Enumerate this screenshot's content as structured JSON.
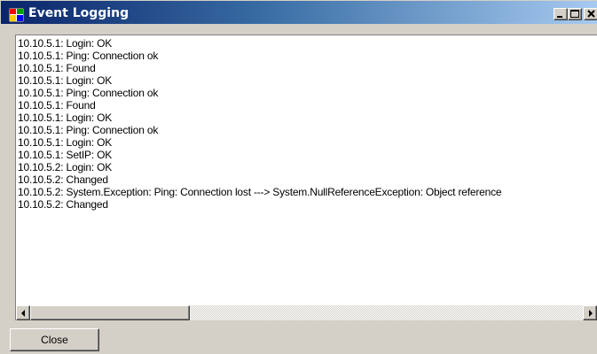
{
  "window": {
    "title": "Event Logging",
    "controls": {
      "minimize_icon": "minimize-icon",
      "maximize_icon": "maximize-icon",
      "close_icon": "close-x-icon"
    }
  },
  "log": {
    "entries": [
      "10.10.5.1: Login: OK",
      "10.10.5.1: Ping: Connection ok",
      "10.10.5.1: Found",
      "10.10.5.1: Login: OK",
      "10.10.5.1: Ping: Connection ok",
      "10.10.5.1: Found",
      "10.10.5.1: Login: OK",
      "10.10.5.1: Ping: Connection ok",
      "10.10.5.1: Login: OK",
      "10.10.5.1: SetIP: OK",
      "10.10.5.2: Login: OK",
      "10.10.5.2: Changed",
      "10.10.5.2: System.Exception: Ping: Connection lost ---> System.NullReferenceException: Object reference",
      "10.10.5.2: Changed"
    ]
  },
  "scrollbar": {
    "left_icon": "arrow-left-icon",
    "right_icon": "arrow-right-icon"
  },
  "footer": {
    "close_label": "Close"
  },
  "colors": {
    "title_gradient_start": "#0a246a",
    "title_gradient_end": "#a6caf0",
    "face": "#d4d0c8",
    "log_background": "#ffffff"
  }
}
